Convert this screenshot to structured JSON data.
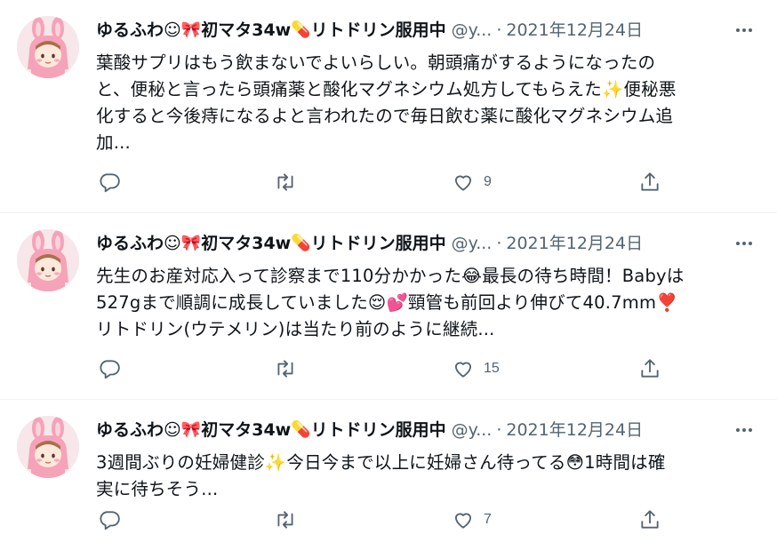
{
  "tweets": [
    {
      "name": "ゆるふわ☺",
      "name_mid": "初マタ34w",
      "name_end": "リトドリン服用中",
      "handle": "@y...",
      "sep": "·",
      "date": "2021年12月24日",
      "lines": [
        "葉酸サプリはもう飲まないでよいらしい。朝頭痛がするようになったの",
        "と、便秘と言ったら頭痛薬と酸化マグネシウム処方してもらえた✨便秘悪",
        "化すると今後痔になるよと言われたので毎日飲む薬に酸化マグネシウム追",
        "加..."
      ],
      "likes": "9"
    },
    {
      "name": "ゆるふわ☺",
      "name_mid": "初マタ34w",
      "name_end": "リトドリン服用中",
      "handle": "@y...",
      "sep": "·",
      "date": "2021年12月24日",
      "lines": [
        "先生のお産対応入って診察まで110分かかった😂最長の待ち時間！Babyは",
        "527gまで順調に成長していました😌💕頸管も前回より伸びて40.7mm❣️",
        "リトドリン(ウテメリン)は当たり前のように継続..."
      ],
      "likes": "15"
    },
    {
      "name": "ゆるふわ☺",
      "name_mid": "初マタ34w",
      "name_end": "リトドリン服用中",
      "handle": "@y...",
      "sep": "·",
      "date": "2021年12月24日",
      "lines": [
        "3週間ぶりの妊婦健診✨今日今まで以上に妊婦さん待ってる😳1時間は確",
        "実に待ちそう..."
      ],
      "likes": "7"
    }
  ],
  "icons": {
    "ribbon": "🎀",
    "pill": "💊",
    "reply": "reply-icon",
    "retweet": "retweet-icon",
    "like": "heart-icon",
    "share": "share-icon",
    "more": "more-icon"
  },
  "colors": {
    "text": "#0f1419",
    "secondary": "#536471",
    "border": "#eff3f4",
    "avatar_pink": "#f5a3b8"
  }
}
